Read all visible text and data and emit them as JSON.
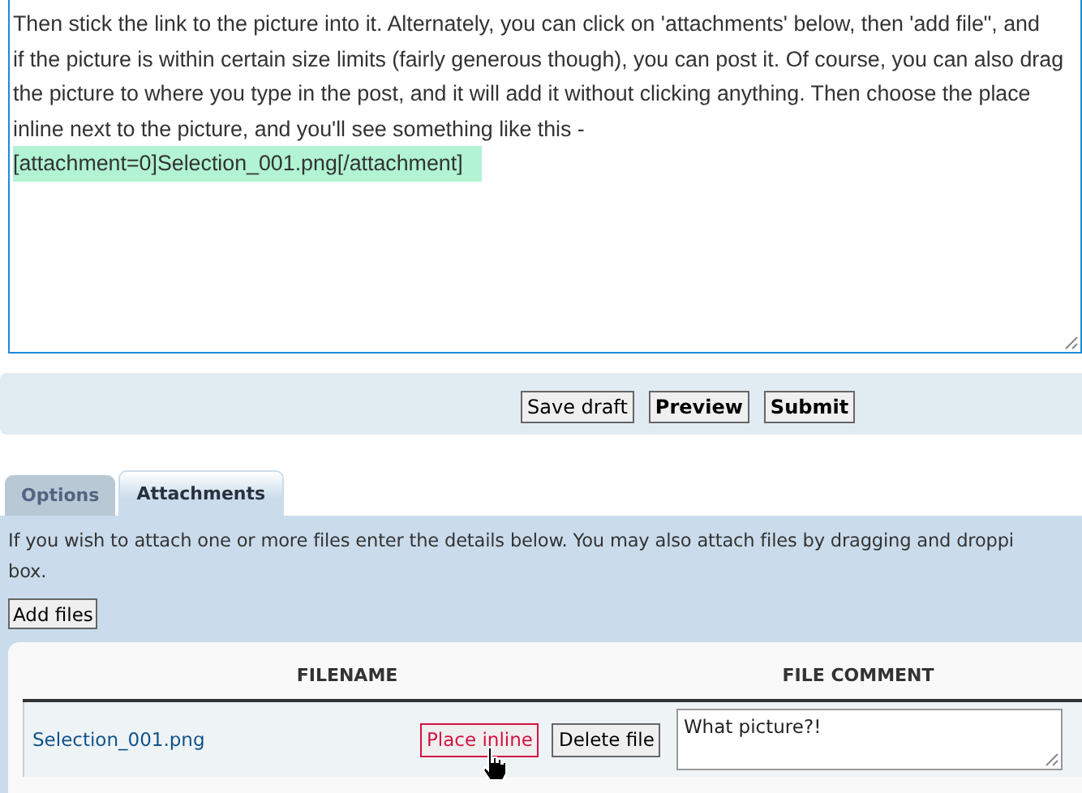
{
  "editor": {
    "lines": [
      {
        "text": "Then stick the link to the picture into it. Alternately, you can click on 'attachments' below, then 'add file\", and",
        "highlighted": false
      },
      {
        "text": "if the picture is within certain size limits (fairly generous though), you can post it. Of course, you can also drag",
        "highlighted": false
      },
      {
        "text": "the picture to where you type in the post, and it will add it without clicking anything. Then choose the place",
        "highlighted": false
      },
      {
        "text": "inline next to the picture, and you'll see something like this -",
        "highlighted": false
      },
      {
        "text": "[attachment=0]Selection_001.png[/attachment]",
        "highlighted": true
      }
    ]
  },
  "buttons": [
    {
      "label": "Save draft",
      "kind": "default"
    },
    {
      "label": "Preview",
      "kind": "primary"
    },
    {
      "label": "Submit",
      "kind": "primary"
    }
  ],
  "tabs": [
    {
      "label": "Options",
      "selected": false
    },
    {
      "label": "Attachments",
      "selected": true
    }
  ],
  "attachments": {
    "intro_lines": [
      "If you wish to attach one or more files enter the details below. You may also attach files by dragging and droppi",
      "box."
    ],
    "add_button": "Add files",
    "columns": [
      "FILENAME",
      "FILE COMMENT"
    ],
    "rows": [
      {
        "filename": "Selection_001.png",
        "place_button": "Place inline",
        "delete_button": "Delete file",
        "comment": "What picture?!"
      }
    ]
  }
}
